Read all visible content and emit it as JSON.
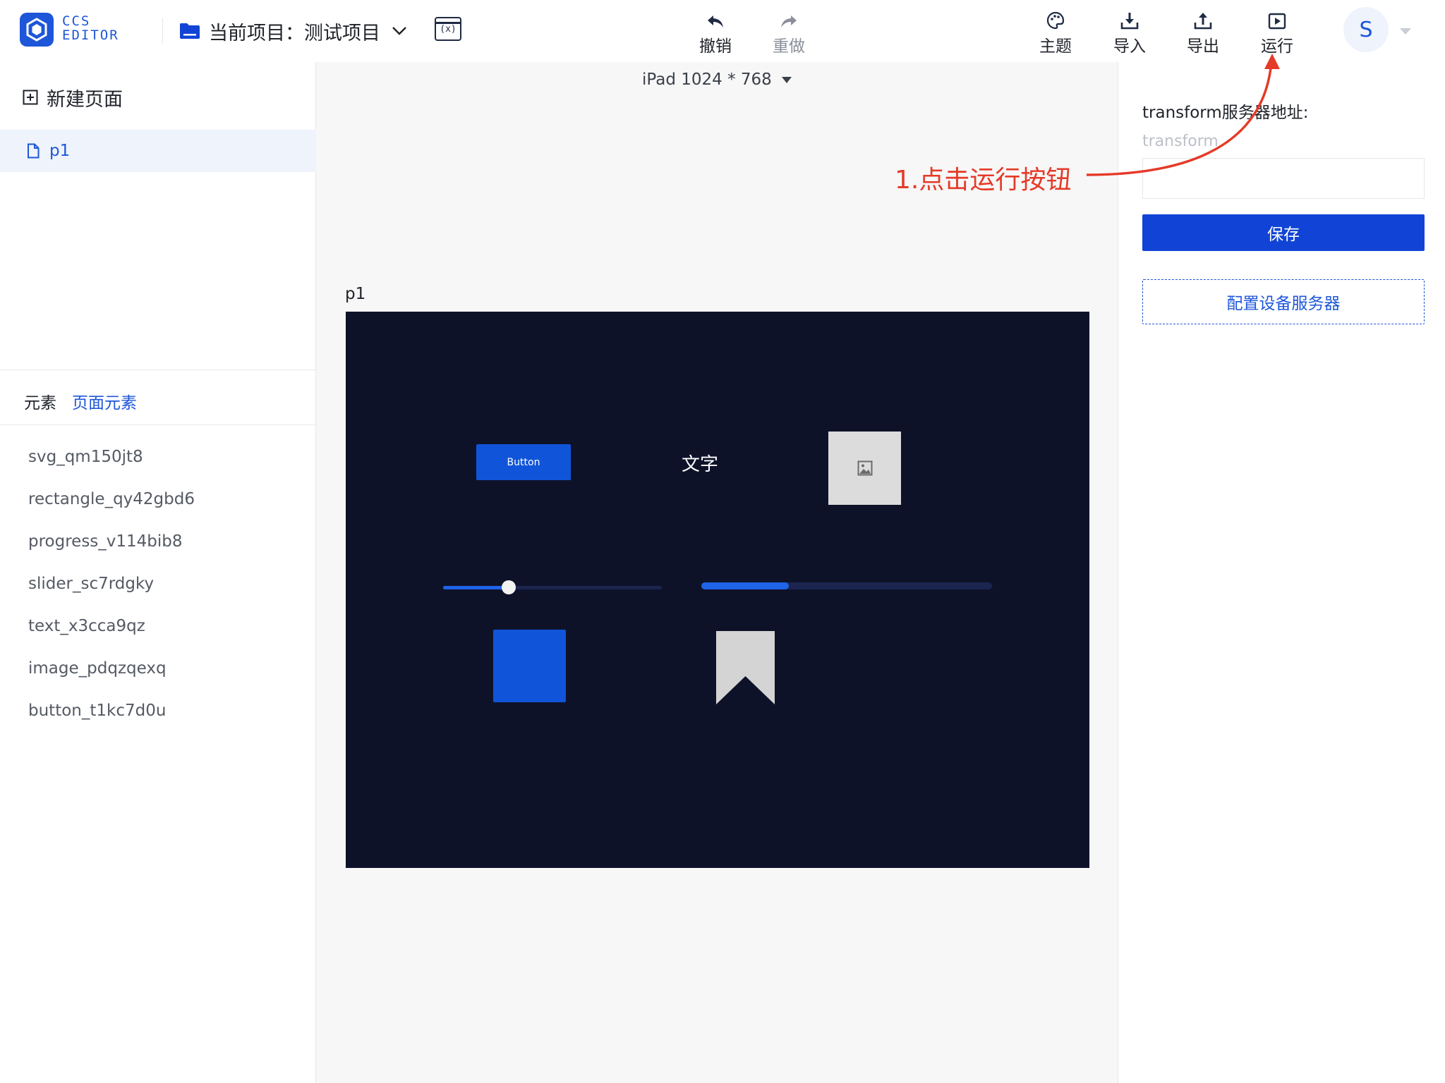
{
  "header": {
    "logo_line1": "CCS",
    "logo_line2": "EDITOR",
    "project_label": "当前项目：",
    "project_name": "测试项目",
    "toolbar": {
      "undo": "撤销",
      "redo": "重做",
      "theme": "主题",
      "import": "导入",
      "export": "导出",
      "run": "运行"
    },
    "avatar_initial": "S"
  },
  "left_panel": {
    "new_page": "新建页面",
    "pages": [
      "p1"
    ],
    "tabs": [
      {
        "label": "元素",
        "active": false
      },
      {
        "label": "页面元素",
        "active": true
      }
    ],
    "elements": [
      "svg_qm150jt8",
      "rectangle_qy42gbd6",
      "progress_v114bib8",
      "slider_sc7rdgky",
      "text_x3cca9qz",
      "image_pdqzqexq",
      "button_t1kc7d0u"
    ]
  },
  "canvas": {
    "device": "iPad 1024 * 768",
    "page_label": "p1",
    "widgets": {
      "button_label": "Button",
      "text_label": "文字",
      "slider_value": 0.3,
      "progress_value": 0.3
    }
  },
  "right_panel": {
    "title": "transform服务器地址:",
    "input_value": "",
    "input_placeholder": "transform",
    "save_label": "保存",
    "config_label": "配置设备服务器"
  },
  "annotation": {
    "text": "1.点击运行按钮"
  },
  "colors": {
    "brand": "#1e56d9",
    "stage_bg": "#0e1229",
    "annotation": "#e53a28"
  }
}
